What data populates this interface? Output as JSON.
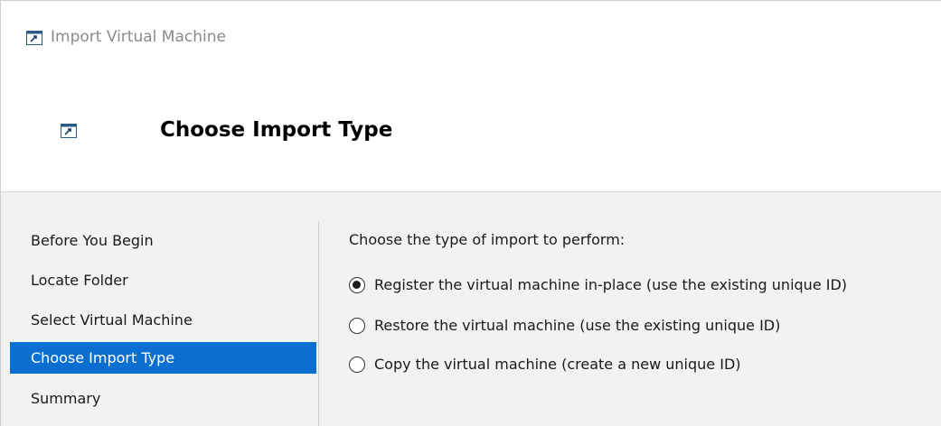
{
  "window": {
    "title": "Import Virtual Machine",
    "icon": "import-vm-icon"
  },
  "header": {
    "title": "Choose Import Type",
    "icon": "import-vm-icon"
  },
  "nav": {
    "items": [
      {
        "label": "Before You Begin",
        "active": false
      },
      {
        "label": "Locate Folder",
        "active": false
      },
      {
        "label": "Select Virtual Machine",
        "active": false
      },
      {
        "label": "Choose Import Type",
        "active": true
      },
      {
        "label": "Summary",
        "active": false
      }
    ],
    "active_color": "#0a6fd1"
  },
  "content": {
    "prompt": "Choose the type of import to perform:",
    "options": [
      {
        "label": "Register the virtual machine in-place (use the existing unique ID)",
        "selected": true
      },
      {
        "label": "Restore the virtual machine (use the existing unique ID)",
        "selected": false
      },
      {
        "label": "Copy the virtual machine (create a new unique ID)",
        "selected": false
      }
    ]
  }
}
